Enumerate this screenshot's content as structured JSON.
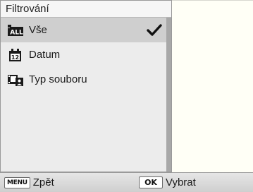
{
  "menu": {
    "title": "Filtrování",
    "items": [
      {
        "label": "Vše",
        "icon": "all-files-icon",
        "selected": true,
        "checked": true
      },
      {
        "label": "Datum",
        "icon": "calendar-date-icon",
        "selected": false,
        "checked": false
      },
      {
        "label": "Typ souboru",
        "icon": "file-type-icon",
        "selected": false,
        "checked": false
      }
    ]
  },
  "footer": {
    "back_key": "MENU",
    "back_label": "Zpět",
    "select_key": "OK",
    "select_label": "Vybrat"
  },
  "colors": {
    "panel_bg": "#ececec",
    "selected_bg": "#cfcfcf",
    "preview_bg": "#fffff6",
    "scroll_thumb": "#a8a8a8"
  }
}
